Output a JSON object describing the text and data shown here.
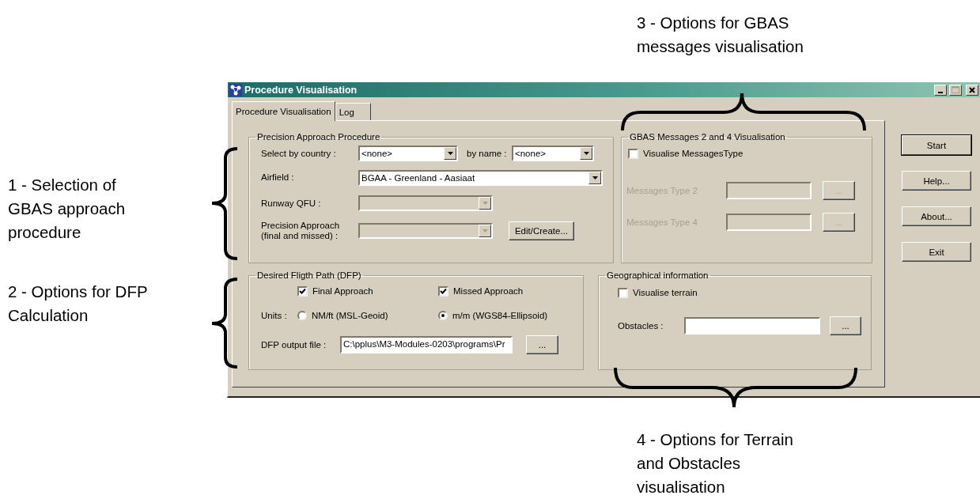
{
  "callouts": [
    {
      "kind": "top",
      "lines": [
        "3 - Options for GBAS",
        "messages visualisation"
      ]
    },
    {
      "kind": "left",
      "lines": [
        "1 - Selection of",
        "GBAS approach",
        "procedure"
      ]
    },
    {
      "kind": "left",
      "lines": [
        "2 - Options for DFP",
        "Calculation"
      ]
    },
    {
      "kind": "bottom",
      "lines": [
        "4 - Options for Terrain",
        "and Obstacles",
        "visualisation"
      ]
    }
  ],
  "window": {
    "title": "Procedure Visualisation"
  },
  "tabs": [
    {
      "label": "Procedure Visualisation",
      "selected": true
    },
    {
      "label": "Log",
      "selected": false
    }
  ],
  "precision_approach": {
    "title": "Precision Approach Procedure",
    "country_label": "Select by country :",
    "country_value": "<none>",
    "name_label": "by name :",
    "name_value": "<none>",
    "airfield_label": "Airfield :",
    "airfield_value": "BGAA - Greenland - Aasiaat",
    "runway_label": "Runway QFU :",
    "runway_disabled": true,
    "approach_label": [
      "Precision Approach",
      "(final and missed) :"
    ],
    "approach_disabled": true,
    "edit_button": "Edit/Create..."
  },
  "gbas": {
    "title": "GBAS Messages 2 and 4 Visualisation",
    "checkbox": {
      "label": "Visualise MessagesType",
      "checked": false
    },
    "rows": [
      {
        "label": "Messages Type 2",
        "disabled": true,
        "button": "..."
      },
      {
        "label": "Messages Type 4",
        "disabled": true,
        "button": "..."
      }
    ]
  },
  "dfp": {
    "title": "Desired Fligth Path (DFP)",
    "checkboxes": [
      {
        "label": "Final Approach",
        "checked": true
      },
      {
        "label": "Missed Approach",
        "checked": true
      }
    ],
    "units_label": "Units :",
    "radios": [
      {
        "label": "NM/ft (MSL-Geoid)",
        "selected": false
      },
      {
        "label": "m/m (WGS84-Ellipsoid)",
        "selected": true
      }
    ],
    "output_label": "DFP output file :",
    "output_value": "C:\\pplus\\M3-Modules-0203\\programs\\Pr",
    "browse_button": "..."
  },
  "geo": {
    "title": "Geographical information",
    "checkbox": {
      "label": "Visualise terrain",
      "checked": false
    },
    "obstacles_label": "Obstacles :",
    "browse_button": "..."
  },
  "side_buttons": [
    "Start",
    "Help...",
    "About...",
    "Exit"
  ]
}
